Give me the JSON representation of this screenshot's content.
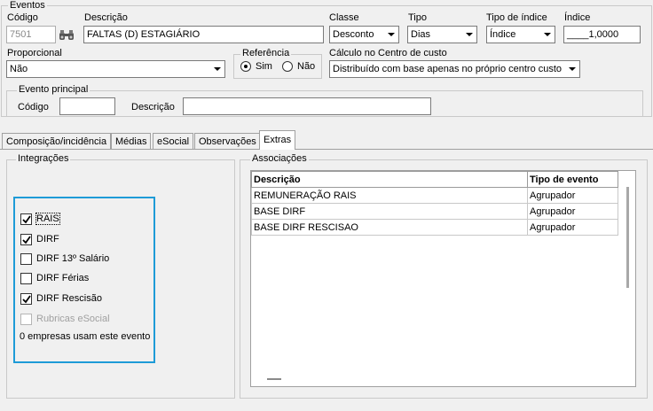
{
  "eventos": {
    "group_title": "Eventos",
    "codigo": {
      "label": "Código",
      "value": "7501"
    },
    "descricao": {
      "label": "Descrição",
      "value": "FALTAS (D) ESTAGIÁRIO"
    },
    "classe": {
      "label": "Classe",
      "value": "Desconto"
    },
    "tipo": {
      "label": "Tipo",
      "value": "Dias"
    },
    "tipo_indice": {
      "label": "Tipo de índice",
      "value": "Índice"
    },
    "indice": {
      "label": "Índice",
      "value": "____1,0000"
    },
    "proporcional": {
      "label": "Proporcional",
      "value": "Não"
    },
    "referencia": {
      "label": "Referência",
      "option_sim": "Sim",
      "option_nao": "Não",
      "selected": "Sim"
    },
    "calculo": {
      "label": "Cálculo no Centro de custo",
      "value": "Distribuído com base apenas no próprio centro custo"
    },
    "evento_principal": {
      "group_title": "Evento principal",
      "codigo_label": "Código",
      "codigo_value": "",
      "descricao_label": "Descrição",
      "descricao_value": ""
    }
  },
  "tabs": [
    {
      "label": "Composição/incidência"
    },
    {
      "label": "Médias"
    },
    {
      "label": "eSocial"
    },
    {
      "label": "Observações"
    },
    {
      "label": "Extras"
    }
  ],
  "integracoes": {
    "group_title": "Integrações",
    "items": [
      {
        "label": "RAIS",
        "checked": true,
        "enabled": true
      },
      {
        "label": "DIRF",
        "checked": true,
        "enabled": true
      },
      {
        "label": "DIRF 13º Salário",
        "checked": false,
        "enabled": true
      },
      {
        "label": "DIRF Férias",
        "checked": false,
        "enabled": true
      },
      {
        "label": "DIRF Rescisão",
        "checked": true,
        "enabled": true
      },
      {
        "label": "Rubricas eSocial",
        "checked": false,
        "enabled": false
      }
    ],
    "status_text": "0 empresas usam este evento",
    "highlight_color": "#1e9bd7"
  },
  "associacoes": {
    "group_title": "Associações",
    "columns": [
      "Descrição",
      "Tipo de evento"
    ],
    "rows": [
      [
        "REMUNERAÇÃO RAIS",
        "Agrupador"
      ],
      [
        "BASE DIRF",
        "Agrupador"
      ],
      [
        "BASE DIRF RESCISAO",
        "Agrupador"
      ]
    ]
  }
}
